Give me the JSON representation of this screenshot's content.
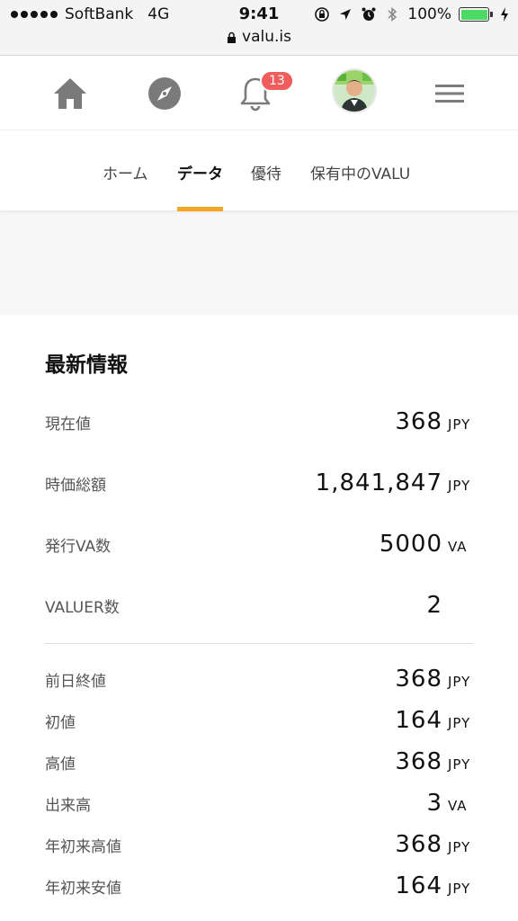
{
  "status_bar": {
    "carrier": "SoftBank",
    "network": "4G",
    "time": "9:41",
    "battery": "100%",
    "url": "valu.is",
    "colors": {
      "battery_fill": "#4cd964"
    }
  },
  "nav": {
    "icons": [
      "home-icon",
      "compass-icon",
      "bell-icon",
      "avatar",
      "menu-icon"
    ],
    "notification_count": "13",
    "colors": {
      "icon": "#7a7a7a",
      "badge": "#f05d5d"
    }
  },
  "tabs": {
    "items": [
      {
        "label": "ホーム",
        "active": false
      },
      {
        "label": "データ",
        "active": true
      },
      {
        "label": "優待",
        "active": false
      },
      {
        "label": "保有中のVALU",
        "active": false
      }
    ],
    "accent_color": "#f5a623"
  },
  "latest": {
    "title": "最新情報",
    "rows": [
      {
        "label": "現在値",
        "value": "368",
        "unit": "JPY"
      },
      {
        "label": "時価総額",
        "value": "1,841,847",
        "unit": "JPY"
      },
      {
        "label": "発行VA数",
        "value": "5000",
        "unit": "VA"
      },
      {
        "label": "VALUER数",
        "value": "2",
        "unit": ""
      }
    ],
    "history": [
      {
        "label": "前日終値",
        "value": "368",
        "unit": "JPY"
      },
      {
        "label": "初値",
        "value": "164",
        "unit": "JPY"
      },
      {
        "label": "高値",
        "value": "368",
        "unit": "JPY"
      },
      {
        "label": "出来高",
        "value": "3",
        "unit": "VA"
      },
      {
        "label": "年初来高値",
        "value": "368",
        "unit": "JPY"
      },
      {
        "label": "年初来安値",
        "value": "164",
        "unit": "JPY"
      }
    ]
  }
}
